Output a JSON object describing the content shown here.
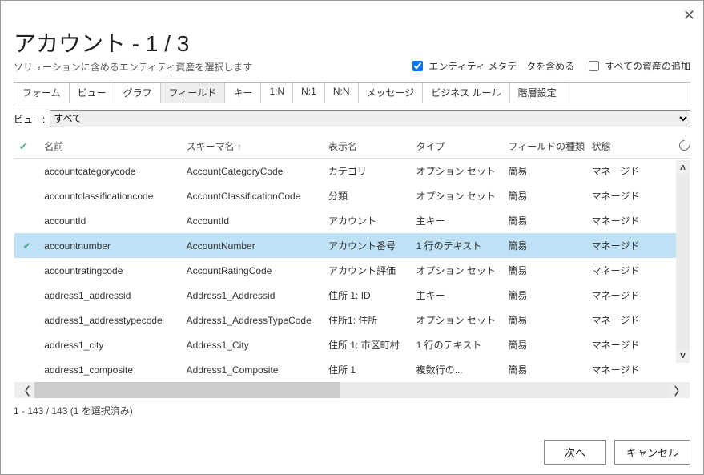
{
  "header": {
    "title": "アカウント - 1 / 3",
    "subtitle": "ソリューションに含めるエンティティ資産を選択します",
    "opt_include_metadata": "エンティティ メタデータを含める",
    "opt_include_metadata_checked": true,
    "opt_add_all_assets": "すべての資産の追加",
    "opt_add_all_assets_checked": false
  },
  "tabs": [
    "フォーム",
    "ビュー",
    "グラフ",
    "フィールド",
    "キー",
    "1:N",
    "N:1",
    "N:N",
    "メッセージ",
    "ビジネス ルール",
    "階層設定"
  ],
  "active_tab_index": 3,
  "view_label": "ビュー:",
  "view_selected": "すべて",
  "columns": {
    "name": "名前",
    "schema": "スキーマ名",
    "display": "表示名",
    "type": "タイプ",
    "fieldkind": "フィールドの種類",
    "state": "状態"
  },
  "rows": [
    {
      "sel": false,
      "name": "accountcategorycode",
      "schema": "AccountCategoryCode",
      "display": "カテゴリ",
      "type": "オプション セット",
      "fieldkind": "簡易",
      "state": "マネージド"
    },
    {
      "sel": false,
      "name": "accountclassificationcode",
      "schema": "AccountClassificationCode",
      "display": "分類",
      "type": "オプション セット",
      "fieldkind": "簡易",
      "state": "マネージド"
    },
    {
      "sel": false,
      "name": "accountId",
      "schema": "AccountId",
      "display": "アカウント",
      "type": "主キー",
      "fieldkind": "簡易",
      "state": "マネージド"
    },
    {
      "sel": true,
      "name": "accountnumber",
      "schema": "AccountNumber",
      "display": "アカウント番号",
      "type": "1 行のテキスト",
      "fieldkind": "簡易",
      "state": "マネージド"
    },
    {
      "sel": false,
      "name": "accountratingcode",
      "schema": "AccountRatingCode",
      "display": "アカウント評価",
      "type": "オプション セット",
      "fieldkind": "簡易",
      "state": "マネージド"
    },
    {
      "sel": false,
      "name": "address1_addressid",
      "schema": "Address1_Addressid",
      "display": "住所 1: ID",
      "type": "主キー",
      "fieldkind": "簡易",
      "state": "マネージド"
    },
    {
      "sel": false,
      "name": "address1_addresstypecode",
      "schema": "Address1_AddressTypeCode",
      "display": "住所1: 住所",
      "type": "オプション セット",
      "fieldkind": "簡易",
      "state": "マネージド"
    },
    {
      "sel": false,
      "name": "address1_city",
      "schema": "Address1_City",
      "display": "住所 1: 市区町村",
      "type": "1 行のテキスト",
      "fieldkind": "簡易",
      "state": "マネージド"
    },
    {
      "sel": false,
      "name": "address1_composite",
      "schema": "Address1_Composite",
      "display": "住所 1",
      "type": "複数行の...",
      "fieldkind": "簡易",
      "state": "マネージド"
    }
  ],
  "status": "1 - 143 / 143 (1 を選択済み)",
  "buttons": {
    "next": "次へ",
    "cancel": "キャンセル"
  }
}
